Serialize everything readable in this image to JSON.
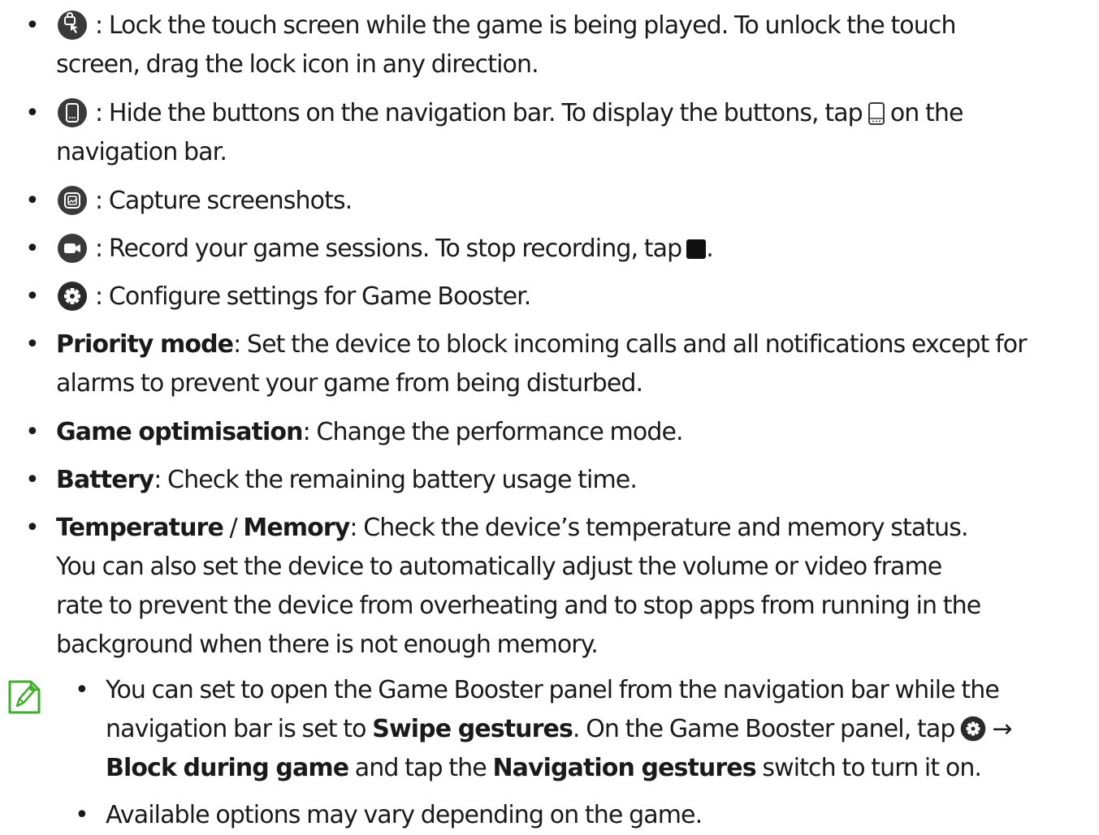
{
  "items": [
    {
      "icon": "touch-lock-icon",
      "line1": ": Lock the touch screen while the game is being played. To unlock the touch",
      "line2": "screen, drag the lock icon in any direction."
    },
    {
      "icon": "navigation-bar-icon",
      "line1_before": ": Hide the buttons on the navigation bar. To display the buttons, tap",
      "line1_after": "on the",
      "line2": "navigation bar."
    },
    {
      "icon": "screenshot-icon",
      "line1": ": Capture screenshots."
    },
    {
      "icon": "record-icon",
      "line1": ": Record your game sessions. To stop recording, tap",
      "line1_after": "."
    },
    {
      "icon": "settings-icon",
      "line1": ": Configure settings for Game Booster."
    },
    {
      "term": "Priority mode",
      "line1": ": Set the device to block incoming calls and all notifications except for",
      "line2": "alarms to prevent your game from being disturbed."
    },
    {
      "term": "Game optimisation",
      "line1": ": Change the performance mode."
    },
    {
      "term": "Battery",
      "line1": ": Check the remaining battery usage time."
    },
    {
      "term": "Temperature",
      "separator": " / ",
      "term2": "Memory",
      "line1": ": Check the device’s temperature and memory status.",
      "line2": "You can also set the device to automatically adjust the volume or video frame",
      "line3": "rate to prevent the device from overheating and to stop apps from running in the",
      "line4": "background when there is not enough memory."
    }
  ],
  "note": {
    "icon": "note-icon",
    "items": [
      {
        "line1": "You can set to open the Game Booster panel from the navigation bar while the",
        "line2_before": "navigation bar is set to ",
        "line2_bold": "Swipe gestures",
        "line2_after": ". On the Game Booster panel, tap",
        "line2_arrow": "→",
        "line3_bold1": "Block during game",
        "line3_mid": " and tap the ",
        "line3_bold2": "Navigation gestures",
        "line3_after": " switch to turn it on."
      },
      {
        "line1": "Available options may vary depending on the game."
      }
    ]
  },
  "bullet": "•",
  "colors": {
    "text": "#1a1a1a",
    "icon_fill": "#3a3a3a",
    "note_green": "#3fae2a"
  }
}
